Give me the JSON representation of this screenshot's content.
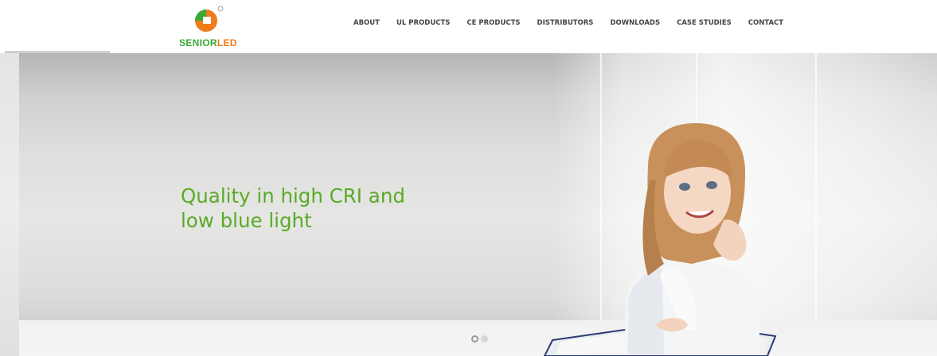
{
  "brand": {
    "logo_text_a": "SENIOR",
    "logo_text_b": "LED",
    "colors": {
      "green": "#39a935",
      "orange": "#ef7b1a"
    }
  },
  "nav": {
    "items": [
      {
        "label": "ABOUT"
      },
      {
        "label": "UL PRODUCTS"
      },
      {
        "label": "CE PRODUCTS"
      },
      {
        "label": "DISTRIBUTORS"
      },
      {
        "label": "DOWNLOADS"
      },
      {
        "label": "CASE STUDIES"
      },
      {
        "label": "CONTACT"
      }
    ]
  },
  "hero": {
    "headline_line1": "Quality in high CRI and",
    "headline_line2": "low blue light",
    "headline_color": "#5aaa27",
    "slide_count": 2,
    "active_slide": 1
  }
}
